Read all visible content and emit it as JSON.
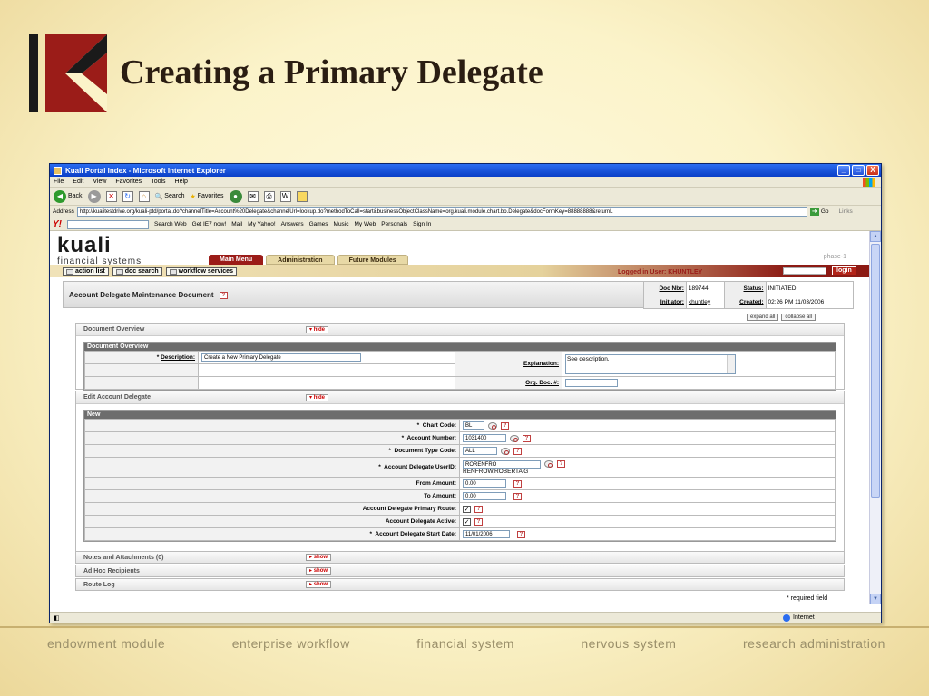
{
  "slide": {
    "title": "Creating a Primary Delegate",
    "logo_letter": "K",
    "footer_items": [
      "endowment module",
      "enterprise workflow",
      "financial system",
      "nervous system",
      "research administration"
    ]
  },
  "browser": {
    "window_title": "Kuali Portal Index - Microsoft Internet Explorer",
    "window_buttons": [
      "_",
      "□",
      "X"
    ],
    "menu": [
      "File",
      "Edit",
      "View",
      "Favorites",
      "Tools",
      "Help"
    ],
    "toolbar": {
      "back_label": "Back",
      "search_label": "Search",
      "favorites_label": "Favorites"
    },
    "address_label": "Address",
    "address_url": "http://kualitestdrive.org/kuali-ptd/portal.do?channelTitle=Account%20Delegate&channelUrl=lookup.do?methodToCall=start&businessObjectClassName=org.kuali.module.chart.bo.Delegate&docFormKey=88888888&returnL",
    "go_label": "Go",
    "links_label": "Links",
    "yahoo_toolbar": [
      "Search Web",
      "Get IE7 now!",
      "Mail",
      "My Yahoo!",
      "Answers",
      "Games",
      "Music",
      "My Web",
      "Personals",
      "Sign In"
    ],
    "status_zone": "Internet"
  },
  "portal": {
    "brand": "kuali",
    "brand_sub": "financial systems",
    "tabs": [
      "Main Menu",
      "Administration",
      "Future Modules"
    ],
    "phase": "phase-1",
    "actions": [
      "action list",
      "doc search",
      "workflow services"
    ],
    "logged_in": "Logged in User: KHUNTLEY",
    "login_button": "login"
  },
  "document": {
    "title": "Account Delegate Maintenance Document",
    "help": "?",
    "info": {
      "doc_nbr_label": "Doc Nbr:",
      "doc_nbr": "189744",
      "status_label": "Status:",
      "status": "INITIATED",
      "initiator_label": "Initiator:",
      "initiator": "khuntley",
      "created_label": "Created:",
      "created": "02:26 PM 11/03/2006"
    },
    "expand_all": "expand all",
    "collapse_all": "collapse all",
    "hide_label": "hide",
    "show_label": "show",
    "overview": {
      "tab_label": "Document Overview",
      "section_label": "Document Overview",
      "description_label": "Description:",
      "description_value": "Create a New Primary Delegate",
      "explanation_label": "Explanation:",
      "explanation_value": "See description.",
      "org_doc_label": "Org. Doc. #:",
      "org_doc_value": ""
    },
    "edit": {
      "tab_label": "Edit Account Delegate",
      "section_label": "New",
      "fields": [
        {
          "label": "Chart Code:",
          "value": "BL",
          "required": true
        },
        {
          "label": "Account Number:",
          "value": "1031400",
          "required": true
        },
        {
          "label": "Document Type Code:",
          "value": "ALL",
          "required": true
        },
        {
          "label": "Account Delegate UserID:",
          "value": "RORENFRO",
          "sub": "RENFROW,ROBERTA G",
          "required": true
        },
        {
          "label": "From Amount:",
          "value": "0.00",
          "required": false
        },
        {
          "label": "To Amount:",
          "value": "0.00",
          "required": false
        },
        {
          "label": "Account Delegate Primary Route:",
          "checked": true,
          "required": false
        },
        {
          "label": "Account Delegate Active:",
          "checked": true,
          "required": false
        },
        {
          "label": "Account Delegate Start Date:",
          "value": "11/01/2006",
          "required": true
        }
      ]
    },
    "collapsed_tabs": [
      "Notes and Attachments (0)",
      "Ad Hoc Recipients",
      "Route Log"
    ],
    "required_note": "* required field",
    "required_marker": "*",
    "check_mark": "✓"
  }
}
